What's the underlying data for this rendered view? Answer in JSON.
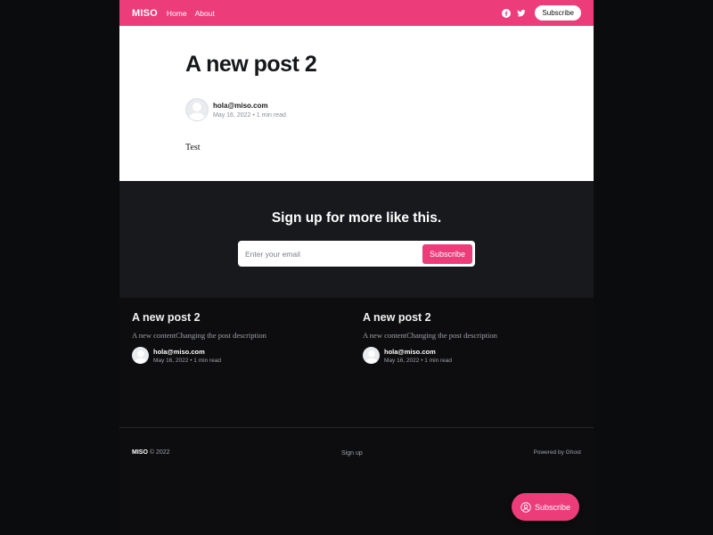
{
  "header": {
    "brand": "MISO",
    "nav_items": [
      "Home",
      "About"
    ],
    "social_icons": [
      "facebook-icon",
      "twitter-icon"
    ],
    "subscribe_label": "Subscribe",
    "accent_color": "#ec3c7a"
  },
  "article": {
    "title": "A new post 2",
    "author": "hola@miso.com",
    "date": "May 16, 2022",
    "read_time": "1 min read",
    "body": "Test"
  },
  "signup": {
    "title": "Sign up for more like this.",
    "email_placeholder": "Enter your email",
    "button_label": "Subscribe"
  },
  "related": [
    {
      "title": "A new post 2",
      "description": "A new contentChanging the post description",
      "author": "hola@miso.com",
      "date": "May 16, 2022",
      "read_time": "1 min read"
    },
    {
      "title": "A new post 2",
      "description": "A new contentChanging the post description",
      "author": "hola@miso.com",
      "date": "May 16, 2022",
      "read_time": "1 min read"
    }
  ],
  "footer": {
    "brand": "MISO",
    "copyright": "© 2022",
    "signup_link": "Sign up",
    "powered_by": "Powered by Ghost"
  },
  "portal": {
    "label": "Subscribe"
  }
}
